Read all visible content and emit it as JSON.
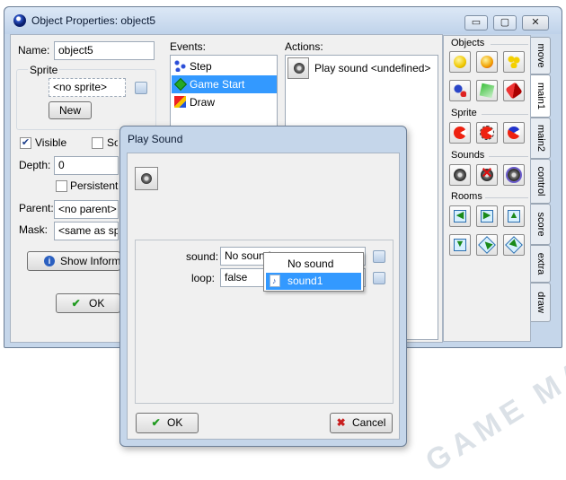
{
  "main_window": {
    "title": "Object Properties: object5",
    "caption_buttons": {
      "minimize": "▭",
      "maximize": "▢",
      "close": "✕"
    }
  },
  "properties": {
    "name_label": "Name:",
    "name_value": "object5",
    "sprite_group_label": "Sprite",
    "sprite_value": "<no sprite>",
    "new_button": "New",
    "visible_label": "Visible",
    "visible_checked": true,
    "solid_label": "Solid",
    "depth_label": "Depth:",
    "depth_value": "0",
    "persistent_label": "Persistent",
    "parent_label": "Parent:",
    "parent_value": "<no parent>",
    "mask_label": "Mask:",
    "mask_value": "<same as sprite>",
    "show_info_button": "Show Information",
    "ok_button": "OK"
  },
  "events": {
    "label": "Events:",
    "items": [
      {
        "label": "Step",
        "icon": "step-icon",
        "selected": false
      },
      {
        "label": "Game Start",
        "icon": "game-start-icon",
        "selected": true
      },
      {
        "label": "Draw",
        "icon": "draw-icon",
        "selected": false
      }
    ]
  },
  "actions": {
    "label": "Actions:",
    "items": [
      {
        "label": "Play sound <undefined>",
        "icon": "speaker-icon"
      }
    ]
  },
  "palette": {
    "sections": {
      "objects": "Objects",
      "sprite": "Sprite",
      "sounds": "Sounds",
      "rooms": "Rooms"
    },
    "tabs": [
      "move",
      "main1",
      "main2",
      "control",
      "score",
      "extra",
      "draw"
    ],
    "active_tab": "main1"
  },
  "dialog": {
    "title": "Play Sound",
    "sound_label": "sound:",
    "sound_value": "No sound",
    "loop_label": "loop:",
    "loop_value": "false",
    "ok_button": "OK",
    "cancel_button": "Cancel",
    "dropdown": [
      {
        "label": "No sound",
        "selected": false
      },
      {
        "label": "sound1",
        "selected": true
      }
    ]
  },
  "colors": {
    "selection": "#3399ff",
    "window_frame": "#c5d6ea",
    "ok_check": "#1f9a1f",
    "cancel_x": "#c81e1e"
  }
}
